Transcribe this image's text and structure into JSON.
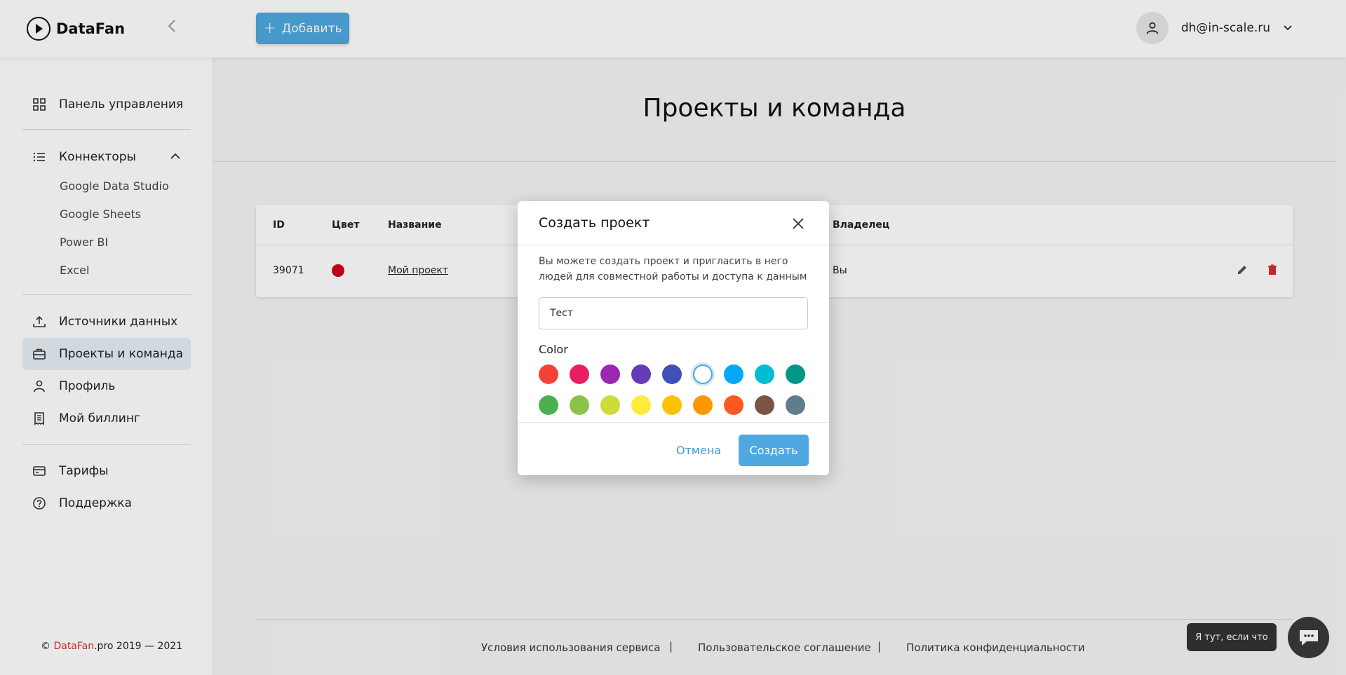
{
  "header": {
    "logo_text": "DataFan",
    "add_button_label": "Добавить",
    "user_email": "dh@in-scale.ru"
  },
  "sidebar": {
    "items": [
      {
        "label": "Панель управления",
        "icon": "grid-icon"
      },
      {
        "label": "Коннекторы",
        "icon": "list-icon"
      },
      {
        "label": "Источники данных",
        "icon": "upload-icon"
      },
      {
        "label": "Проекты и команда",
        "icon": "briefcase-icon"
      },
      {
        "label": "Профиль",
        "icon": "user-icon"
      },
      {
        "label": "Мой биллинг",
        "icon": "receipt-icon"
      },
      {
        "label": "Тарифы",
        "icon": "card-icon"
      },
      {
        "label": "Поддержка",
        "icon": "help-icon"
      }
    ],
    "connectors": [
      "Google Data Studio",
      "Google Sheets",
      "Power BI",
      "Excel"
    ],
    "copyright_prefix": "© ",
    "copyright_brand": "DataFan",
    "copyright_suffix": ".pro 2019 — 2021"
  },
  "page": {
    "title": "Проекты и команда"
  },
  "table": {
    "columns": [
      "ID",
      "Цвет",
      "Название",
      "Владелец"
    ],
    "rows": [
      {
        "id": "39071",
        "color": "#d0021b",
        "name": "Мой проект",
        "owner": "Вы"
      }
    ]
  },
  "footer": {
    "links": [
      "Условия использования сервиса",
      "Пользовательское соглашение",
      "Политика конфиденциальности"
    ],
    "separator": "|"
  },
  "chat": {
    "tooltip": "Я тут, если что"
  },
  "modal": {
    "title": "Создать проект",
    "description": "Вы можете создать проект и пригласить в него людей для совместной работы и доступа к данным",
    "input_value": "Тест",
    "color_label": "Color",
    "colors": [
      "#f44336",
      "#e91e63",
      "#9c27b0",
      "#673ab7",
      "#3f51b5",
      "#ffffff",
      "#03a9f4",
      "#00bcd4",
      "#009688",
      "#4caf50",
      "#8bc34a",
      "#cddc39",
      "#ffeb3b",
      "#ffc107",
      "#ff9800",
      "#ff5722",
      "#795548",
      "#607d8b"
    ],
    "selected_color_index": 5,
    "cancel_label": "Отмена",
    "create_label": "Создать"
  }
}
